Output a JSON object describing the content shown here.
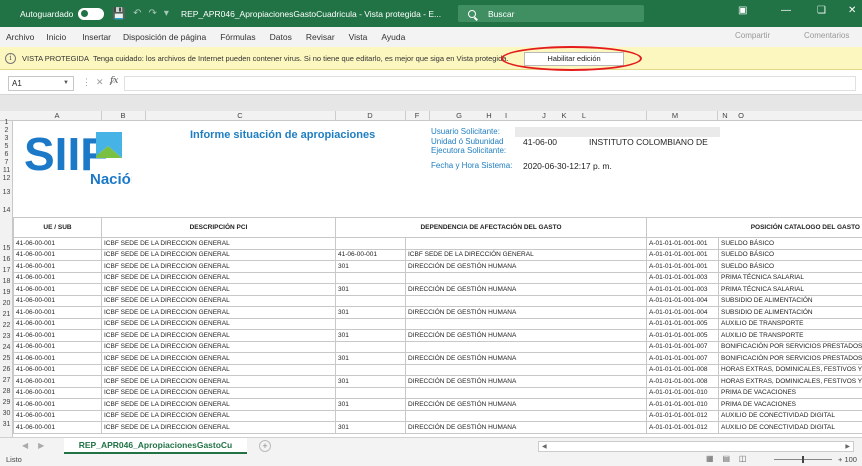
{
  "titlebar": {
    "autosave_label": "Autoguardado",
    "doc_title": "REP_APR046_ApropiacionesGastoCuadricula - Vista protegida - E...",
    "search_placeholder": "Buscar",
    "color": "#217346"
  },
  "ribbon_tabs": [
    "Archivo",
    "Inicio",
    "Insertar",
    "Disposición de página",
    "Fórmulas",
    "Datos",
    "Revisar",
    "Vista",
    "Ayuda"
  ],
  "ribbon_right": {
    "share": "Compartir",
    "comments": "Comentarios"
  },
  "protected_view": {
    "title": "VISTA PROTEGIDA",
    "message": "Tenga cuidado: los archivos de Internet pueden contener virus. Si no tiene que editarlo, es mejor que siga en Vista protegida.",
    "enable_button": "Habilitar edición",
    "highlight_color": "#e31b1b"
  },
  "formula_bar": {
    "name_box": "A1",
    "fx": "fx",
    "value": ""
  },
  "columns": [
    "A",
    "B",
    "C",
    "D",
    "F",
    "G",
    "H",
    "I",
    "J",
    "K",
    "L",
    "M",
    "N",
    "O"
  ],
  "rows_header": [
    "1",
    "2",
    "3",
    "5",
    "6",
    "7",
    "11",
    "12",
    "13",
    "14",
    "15",
    "16",
    "17",
    "18",
    "19",
    "20",
    "21",
    "22",
    "23",
    "24",
    "25",
    "26",
    "27",
    "28",
    "29",
    "30",
    "31"
  ],
  "report": {
    "logo_text": "SIIF",
    "logo_sub": "Nación",
    "title": "Informe situación de apropiaciones",
    "user_label": "Usuario Solicitante:",
    "unit_label": "Unidad ó Subunidad",
    "executor_label": "Ejecutora Solicitante:",
    "unit_code": "41-06-00",
    "unit_name": "INSTITUTO COLOMBIANO DE",
    "date_label": "Fecha y Hora Sistema:",
    "date_value": "2020-06-30-12:17 p. m."
  },
  "table": {
    "headers": [
      "UE / SUB",
      "DESCRIPCIÓN PCI",
      "DEPENDENCIA DE AFECTACIÓN DEL GASTO",
      "POSICIÓN CATALOGO DEL GASTO"
    ],
    "rows": [
      {
        "rn": "15",
        "ue": "41-06-00-001",
        "pci": "ICBF SEDE DE LA DIRECCION GENERAL",
        "dep_code": "",
        "dep_name": "",
        "pos_code": "A-01-01-01-001-001",
        "pos_name": "SUELDO BÁSICO"
      },
      {
        "rn": "16",
        "ue": "41-06-00-001",
        "pci": "ICBF SEDE DE LA DIRECCION GENERAL",
        "dep_code": "41-06-00-001",
        "dep_name": "ICBF SEDE DE LA DIRECCIÓN GENERAL",
        "pos_code": "A-01-01-01-001-001",
        "pos_name": "SUELDO BÁSICO"
      },
      {
        "rn": "17",
        "ue": "41-06-00-001",
        "pci": "ICBF SEDE DE LA DIRECCION GENERAL",
        "dep_code": "301",
        "dep_name": "DIRECCIÓN DE GESTIÓN HUMANA",
        "pos_code": "A-01-01-01-001-001",
        "pos_name": "SUELDO BÁSICO"
      },
      {
        "rn": "18",
        "ue": "41-06-00-001",
        "pci": "ICBF SEDE DE LA DIRECCION GENERAL",
        "dep_code": "",
        "dep_name": "",
        "pos_code": "A-01-01-01-001-003",
        "pos_name": "PRIMA TÉCNICA SALARIAL"
      },
      {
        "rn": "19",
        "ue": "41-06-00-001",
        "pci": "ICBF SEDE DE LA DIRECCION GENERAL",
        "dep_code": "301",
        "dep_name": "DIRECCIÓN DE GESTIÓN HUMANA",
        "pos_code": "A-01-01-01-001-003",
        "pos_name": "PRIMA TÉCNICA SALARIAL"
      },
      {
        "rn": "20",
        "ue": "41-06-00-001",
        "pci": "ICBF SEDE DE LA DIRECCION GENERAL",
        "dep_code": "",
        "dep_name": "",
        "pos_code": "A-01-01-01-001-004",
        "pos_name": "SUBSIDIO DE ALIMENTACIÓN"
      },
      {
        "rn": "21",
        "ue": "41-06-00-001",
        "pci": "ICBF SEDE DE LA DIRECCION GENERAL",
        "dep_code": "301",
        "dep_name": "DIRECCIÓN DE GESTIÓN HUMANA",
        "pos_code": "A-01-01-01-001-004",
        "pos_name": "SUBSIDIO DE ALIMENTACIÓN"
      },
      {
        "rn": "22",
        "ue": "41-06-00-001",
        "pci": "ICBF SEDE DE LA DIRECCION GENERAL",
        "dep_code": "",
        "dep_name": "",
        "pos_code": "A-01-01-01-001-005",
        "pos_name": "AUXILIO DE TRANSPORTE"
      },
      {
        "rn": "23",
        "ue": "41-06-00-001",
        "pci": "ICBF SEDE DE LA DIRECCION GENERAL",
        "dep_code": "301",
        "dep_name": "DIRECCIÓN DE GESTIÓN HUMANA",
        "pos_code": "A-01-01-01-001-005",
        "pos_name": "AUXILIO DE TRANSPORTE"
      },
      {
        "rn": "24",
        "ue": "41-06-00-001",
        "pci": "ICBF SEDE DE LA DIRECCION GENERAL",
        "dep_code": "",
        "dep_name": "",
        "pos_code": "A-01-01-01-001-007",
        "pos_name": "BONIFICACIÓN POR SERVICIOS PRESTADOS"
      },
      {
        "rn": "25",
        "ue": "41-06-00-001",
        "pci": "ICBF SEDE DE LA DIRECCION GENERAL",
        "dep_code": "301",
        "dep_name": "DIRECCIÓN DE GESTIÓN HUMANA",
        "pos_code": "A-01-01-01-001-007",
        "pos_name": "BONIFICACIÓN POR SERVICIOS PRESTADOS"
      },
      {
        "rn": "26",
        "ue": "41-06-00-001",
        "pci": "ICBF SEDE DE LA DIRECCION GENERAL",
        "dep_code": "",
        "dep_name": "",
        "pos_code": "A-01-01-01-001-008",
        "pos_name": "HORAS EXTRAS, DOMINICALES, FESTIVOS Y"
      },
      {
        "rn": "27",
        "ue": "41-06-00-001",
        "pci": "ICBF SEDE DE LA DIRECCION GENERAL",
        "dep_code": "301",
        "dep_name": "DIRECCIÓN DE GESTIÓN HUMANA",
        "pos_code": "A-01-01-01-001-008",
        "pos_name": "HORAS EXTRAS, DOMINICALES, FESTIVOS Y"
      },
      {
        "rn": "28",
        "ue": "41-06-00-001",
        "pci": "ICBF SEDE DE LA DIRECCION GENERAL",
        "dep_code": "",
        "dep_name": "",
        "pos_code": "A-01-01-01-001-010",
        "pos_name": "PRIMA DE VACACIONES"
      },
      {
        "rn": "29",
        "ue": "41-06-00-001",
        "pci": "ICBF SEDE DE LA DIRECCION GENERAL",
        "dep_code": "301",
        "dep_name": "DIRECCIÓN DE GESTIÓN HUMANA",
        "pos_code": "A-01-01-01-001-010",
        "pos_name": "PRIMA DE VACACIONES"
      },
      {
        "rn": "30",
        "ue": "41-06-00-001",
        "pci": "ICBF SEDE DE LA DIRECCION GENERAL",
        "dep_code": "",
        "dep_name": "",
        "pos_code": "A-01-01-01-001-012",
        "pos_name": "AUXILIO DE CONECTIVIDAD DIGITAL"
      },
      {
        "rn": "31",
        "ue": "41-06-00-001",
        "pci": "ICBF SEDE DE LA DIRECCION GENERAL",
        "dep_code": "301",
        "dep_name": "DIRECCIÓN DE GESTIÓN HUMANA",
        "pos_code": "A-01-01-01-001-012",
        "pos_name": "AUXILIO DE CONECTIVIDAD DIGITAL"
      }
    ]
  },
  "sheet_tab": "REP_APR046_ApropiacionesGastoCu",
  "status": {
    "ready": "Listo",
    "zoom": "+ 100"
  }
}
